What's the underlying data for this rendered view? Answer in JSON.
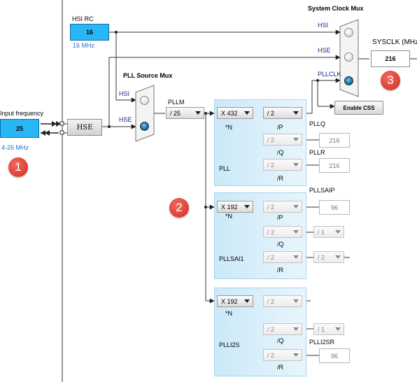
{
  "title": "System Clock Mux",
  "hsi_rc": {
    "label": "HSI RC",
    "value": "16",
    "freq": "16 MHz"
  },
  "input": {
    "label": "Input frequency",
    "value": "25",
    "range": "4-26 MHz",
    "hse_block": "HSE"
  },
  "pll_source_mux": {
    "label": "PLL Source Mux",
    "hsi": "HSI",
    "hse": "HSE"
  },
  "pllm": {
    "label": "PLLM",
    "value": "/ 25"
  },
  "sys_mux": {
    "hsi": "HSI",
    "hse": "HSE",
    "pllclk": "PLLCLK",
    "css_button": "Enable CSS"
  },
  "sysclk": {
    "label": "SYSCLK (MHz)",
    "value": "216"
  },
  "pll": {
    "name": "PLL",
    "n": "X 432",
    "n_label": "*N",
    "p": "/ 2",
    "p_label": "/P",
    "q": "/ 2",
    "q_label": "/Q",
    "q_out_label": "PLLQ",
    "q_out": "216",
    "r": "/ 2",
    "r_label": "/R",
    "r_out_label": "PLLR",
    "r_out": "216"
  },
  "pllsai1": {
    "name": "PLLSAI1",
    "n": "X 192",
    "n_label": "*N",
    "p": "/ 2",
    "p_label": "/P",
    "p_out_label": "PLLSAIP",
    "p_out": "96",
    "q": "/ 2",
    "q_label": "/Q",
    "q_div2": "/ 1",
    "r": "/ 2",
    "r_label": "/R",
    "r_div2": "/ 2"
  },
  "plli2s": {
    "name": "PLLI2S",
    "n": "X 192",
    "n_label": "*N",
    "p": "/ 2",
    "q": "/ 2",
    "q_label": "/Q",
    "q_div2": "/ 1",
    "r": "/ 2",
    "r_label": "/R",
    "r_out_label": "PLLI2SR",
    "r_out": "96"
  },
  "badges": [
    "1",
    "2",
    "3"
  ],
  "colors": {
    "cyan_box": "#29b6f6",
    "accent_blue": "#1f6fd6",
    "badge_red": "#d42b1f",
    "panel": "#cbe9f8"
  }
}
